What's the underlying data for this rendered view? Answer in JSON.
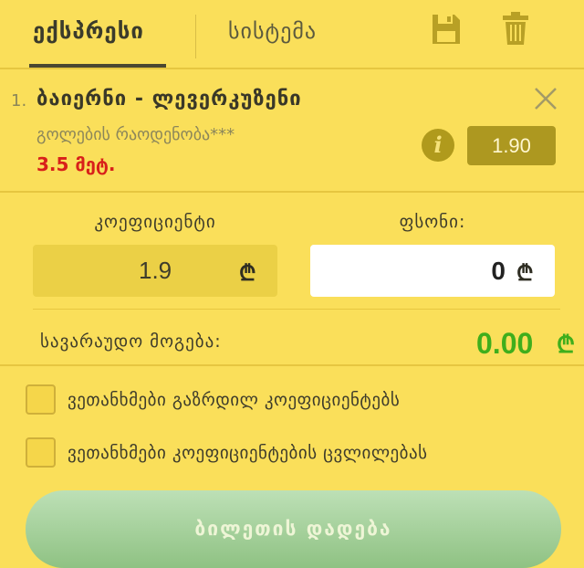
{
  "tabs": {
    "express_label": "ექსპრესი",
    "system_label": "სისტემა"
  },
  "toolbar": {
    "save_icon": "floppy-disk-icon",
    "delete_icon": "trash-icon"
  },
  "bet": {
    "number": "1.",
    "title": "ბაიერნი - ლევერკუზენი",
    "market": "გოლების რაოდენობა***",
    "selection": "3.5 მეტ.",
    "odds": "1.90",
    "close_icon": "close-icon",
    "info_icon_glyph": "i"
  },
  "fields": {
    "coefficient_label": "კოეფიციენტი",
    "coefficient_value": "1.9",
    "stake_label": "ფსონი:",
    "stake_value": "0",
    "currency_symbol": "₾"
  },
  "winnings": {
    "label": "სავარაუდო მოგება:",
    "value": "0.00",
    "currency_symbol": "₾"
  },
  "options": [
    {
      "label": "ვეთანხმები გაზრდილ კოეფიციენტებს",
      "checked": false
    },
    {
      "label": "ვეთანხმები კოეფიციენტების ცვლილებას",
      "checked": false
    }
  ],
  "place_button": {
    "label": "ბილეთის დადება"
  },
  "colors": {
    "background": "#fadf5a",
    "odds_badge": "#ad9820",
    "selection_red": "#d8201a",
    "winnings_green": "#3fae1c",
    "button_green": "#a8d29e"
  }
}
